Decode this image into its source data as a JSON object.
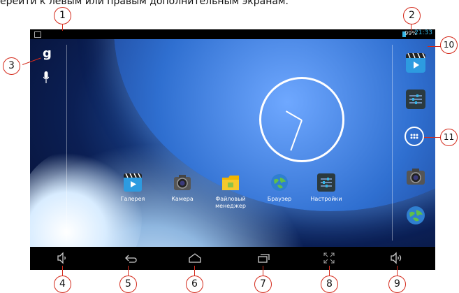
{
  "caption": "ерейти к левым или правым дополнительным экранам.",
  "status_bar": {
    "battery": "99%",
    "time": "21:33"
  },
  "search": {
    "google_label": "g"
  },
  "apps": [
    {
      "label": "Галерея"
    },
    {
      "label": "Камера"
    },
    {
      "label": "Файловый менеджер"
    },
    {
      "label": "Браузер"
    },
    {
      "label": "Настройки"
    }
  ],
  "callouts": [
    "1",
    "2",
    "3",
    "4",
    "5",
    "6",
    "7",
    "8",
    "9",
    "10",
    "11"
  ],
  "colors": {
    "accent": "#33b5e5",
    "callout": "#d42a1b"
  }
}
